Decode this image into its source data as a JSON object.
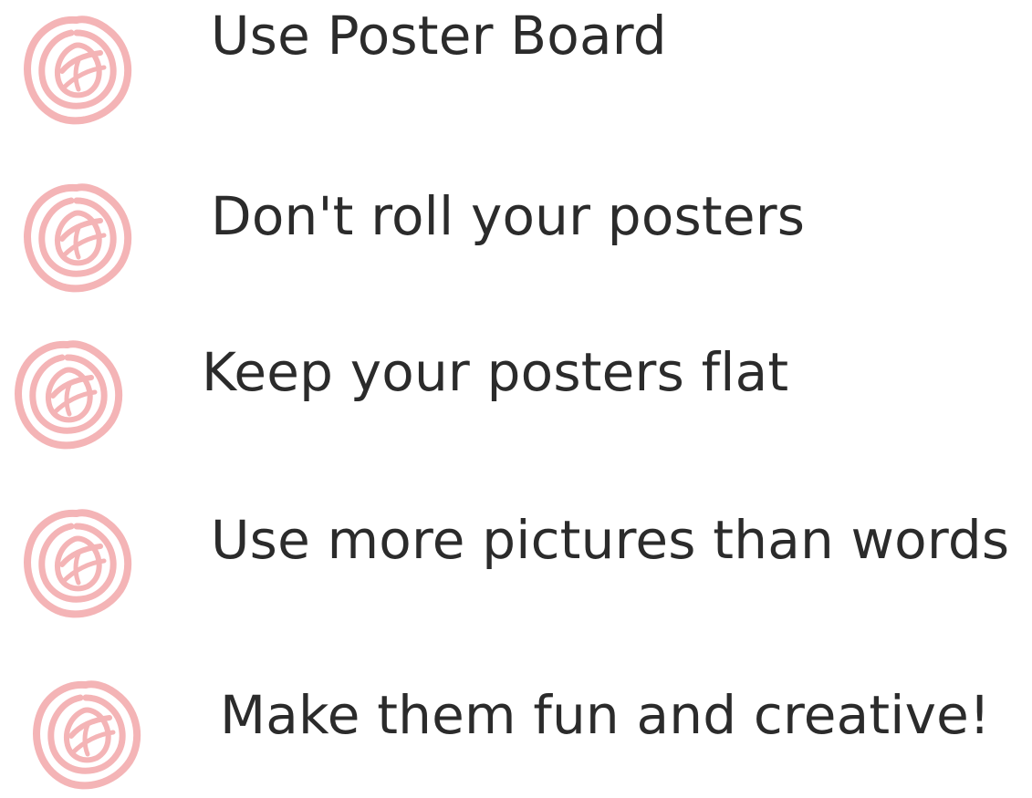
{
  "accent_color": "#f4b4b6",
  "text_color": "#2b2b2b",
  "tips": [
    {
      "icon": "scribble-bullet-icon",
      "text": "Use Poster Board"
    },
    {
      "icon": "scribble-bullet-icon",
      "text": "Don't roll your posters"
    },
    {
      "icon": "scribble-bullet-icon",
      "text": "Keep your posters flat"
    },
    {
      "icon": "scribble-bullet-icon",
      "text": "Use more pictures than words"
    },
    {
      "icon": "scribble-bullet-icon",
      "text": "Make them fun and creative!"
    }
  ]
}
